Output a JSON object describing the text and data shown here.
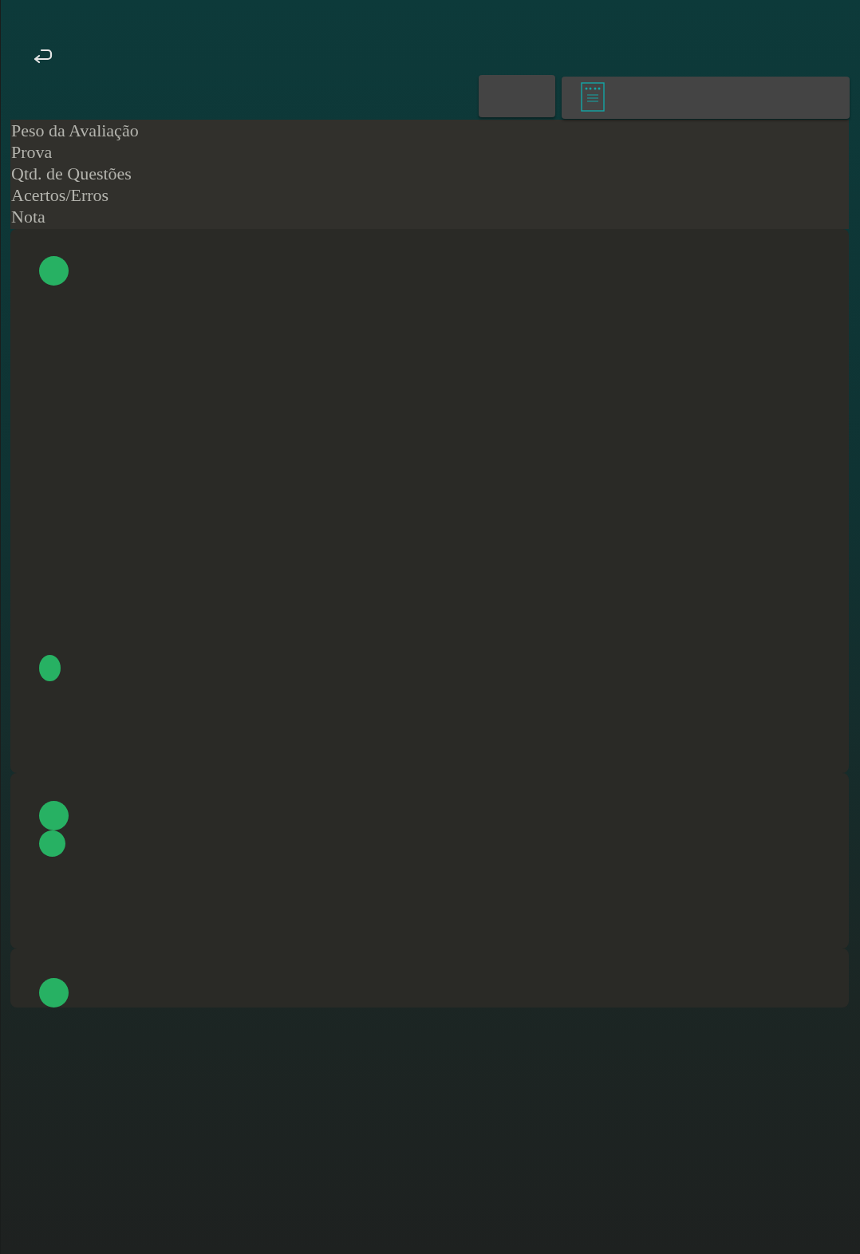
{
  "header_labels": [
    "Peso da Avaliação",
    "Prova",
    "Qtd. de Questões",
    "Acertos/Erros",
    "Nota"
  ],
  "cards": [
    {
      "dots": [
        {
          "kind": "large"
        },
        {
          "kind": "oval"
        }
      ]
    },
    {
      "dots": [
        {
          "kind": "large"
        },
        {
          "kind": "small"
        }
      ]
    },
    {
      "dots": [
        {
          "kind": "large"
        }
      ]
    }
  ]
}
